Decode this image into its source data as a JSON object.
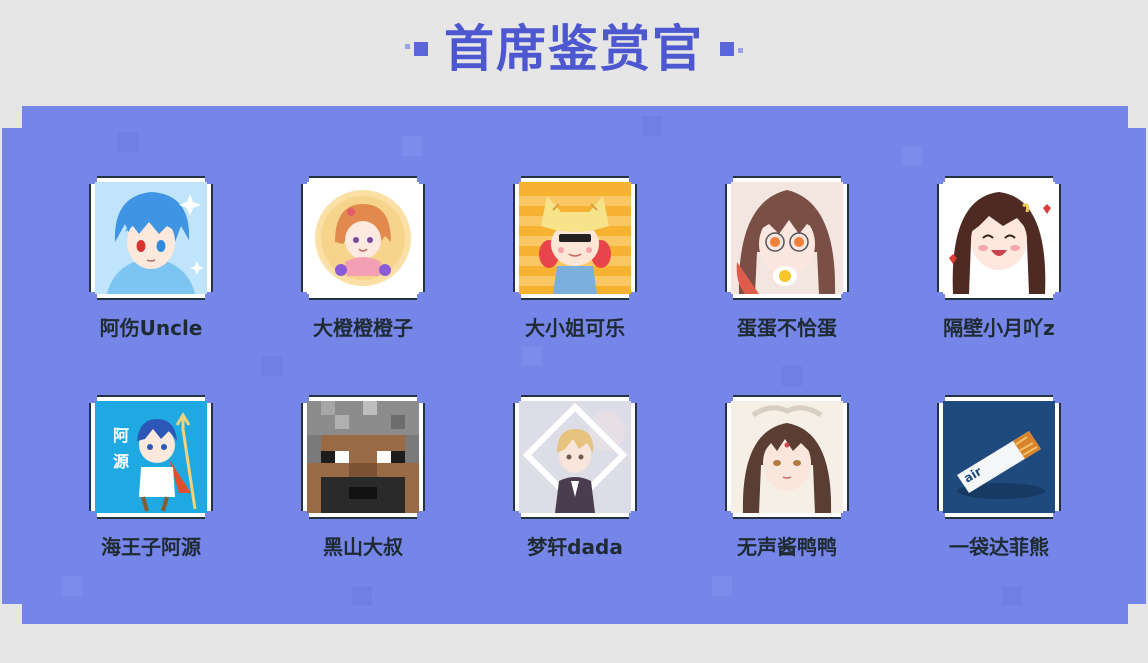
{
  "title": "首席鉴赏官",
  "colors": {
    "background": "#e6e6e6",
    "panel": "#7585e8",
    "title": "#4d58d0",
    "frame_border": "#243340",
    "name_text": "#1f2b33"
  },
  "members": [
    {
      "name": "阿伤Uncle",
      "avatar": "blue-haired-anime-boy-avatar"
    },
    {
      "name": "大橙橙橙子",
      "avatar": "orange-haired-chibi-girl-avatar"
    },
    {
      "name": "大小姐可乐",
      "avatar": "cat-hat-girl-avatar"
    },
    {
      "name": "蛋蛋不恰蛋",
      "avatar": "glasses-girl-egg-avatar"
    },
    {
      "name": "隔壁小月吖z",
      "avatar": "smiling-brunette-girl-avatar"
    },
    {
      "name": "海王子阿源",
      "avatar": "trident-boy-avatar",
      "avatar_text": [
        "阿",
        "源"
      ]
    },
    {
      "name": "黑山大叔",
      "avatar": "pixel-bearded-man-avatar"
    },
    {
      "name": "梦轩dada",
      "avatar": "blonde-boy-diamond-frame-avatar"
    },
    {
      "name": "无声酱鸭鸭",
      "avatar": "mystic-long-hair-girl-avatar"
    },
    {
      "name": "一袋达菲熊",
      "avatar": "air-stick-product-avatar",
      "avatar_text": [
        "air"
      ]
    }
  ]
}
